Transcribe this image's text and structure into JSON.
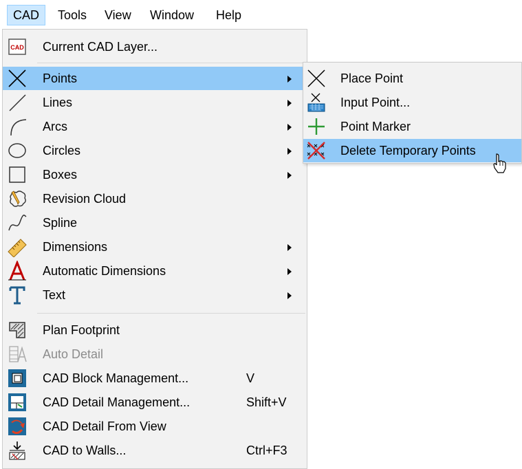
{
  "menubar": {
    "items": [
      {
        "label": "CAD",
        "active": true
      },
      {
        "label": "Tools"
      },
      {
        "label": "View"
      },
      {
        "label": "Window"
      },
      {
        "label": "Help"
      }
    ]
  },
  "cad_menu": {
    "items": [
      {
        "label": "Current CAD Layer...",
        "icon": "cad-layer-icon",
        "icon_text": "CAD"
      },
      {
        "label": "Points",
        "icon": "point-x-icon",
        "submenu": true,
        "highlighted": true
      },
      {
        "label": "Lines",
        "icon": "line-icon",
        "submenu": true
      },
      {
        "label": "Arcs",
        "icon": "arc-icon",
        "submenu": true
      },
      {
        "label": "Circles",
        "icon": "circle-icon",
        "submenu": true
      },
      {
        "label": "Boxes",
        "icon": "box-icon",
        "submenu": true
      },
      {
        "label": "Revision Cloud",
        "icon": "revision-cloud-icon"
      },
      {
        "label": "Spline",
        "icon": "spline-icon"
      },
      {
        "label": "Dimensions",
        "icon": "ruler-icon",
        "submenu": true
      },
      {
        "label": "Automatic Dimensions",
        "icon": "auto-dimension-icon",
        "submenu": true
      },
      {
        "label": "Text",
        "icon": "text-icon",
        "submenu": true
      },
      {
        "label": "Plan Footprint",
        "icon": "plan-footprint-icon"
      },
      {
        "label": "Auto Detail",
        "icon": "auto-detail-icon",
        "disabled": true
      },
      {
        "label": "CAD Block Management...",
        "icon": "block-management-icon",
        "shortcut": "V"
      },
      {
        "label": "CAD Detail Management...",
        "icon": "detail-management-icon",
        "shortcut": "Shift+V"
      },
      {
        "label": "CAD Detail From View",
        "icon": "detail-from-view-icon"
      },
      {
        "label": "CAD to Walls...",
        "icon": "cad-to-walls-icon",
        "shortcut": "Ctrl+F3"
      }
    ]
  },
  "points_submenu": {
    "items": [
      {
        "label": "Place Point",
        "icon": "place-point-icon"
      },
      {
        "label": "Input Point...",
        "icon": "input-point-icon"
      },
      {
        "label": "Point Marker",
        "icon": "point-marker-icon"
      },
      {
        "label": "Delete Temporary Points",
        "icon": "delete-temporary-points-icon",
        "highlighted": true
      }
    ]
  },
  "colors": {
    "highlight": "#91c9f7",
    "menu_bg": "#f2f2f2",
    "menubar_active": "#cce8ff",
    "disabled_text": "#8c8c8c"
  }
}
